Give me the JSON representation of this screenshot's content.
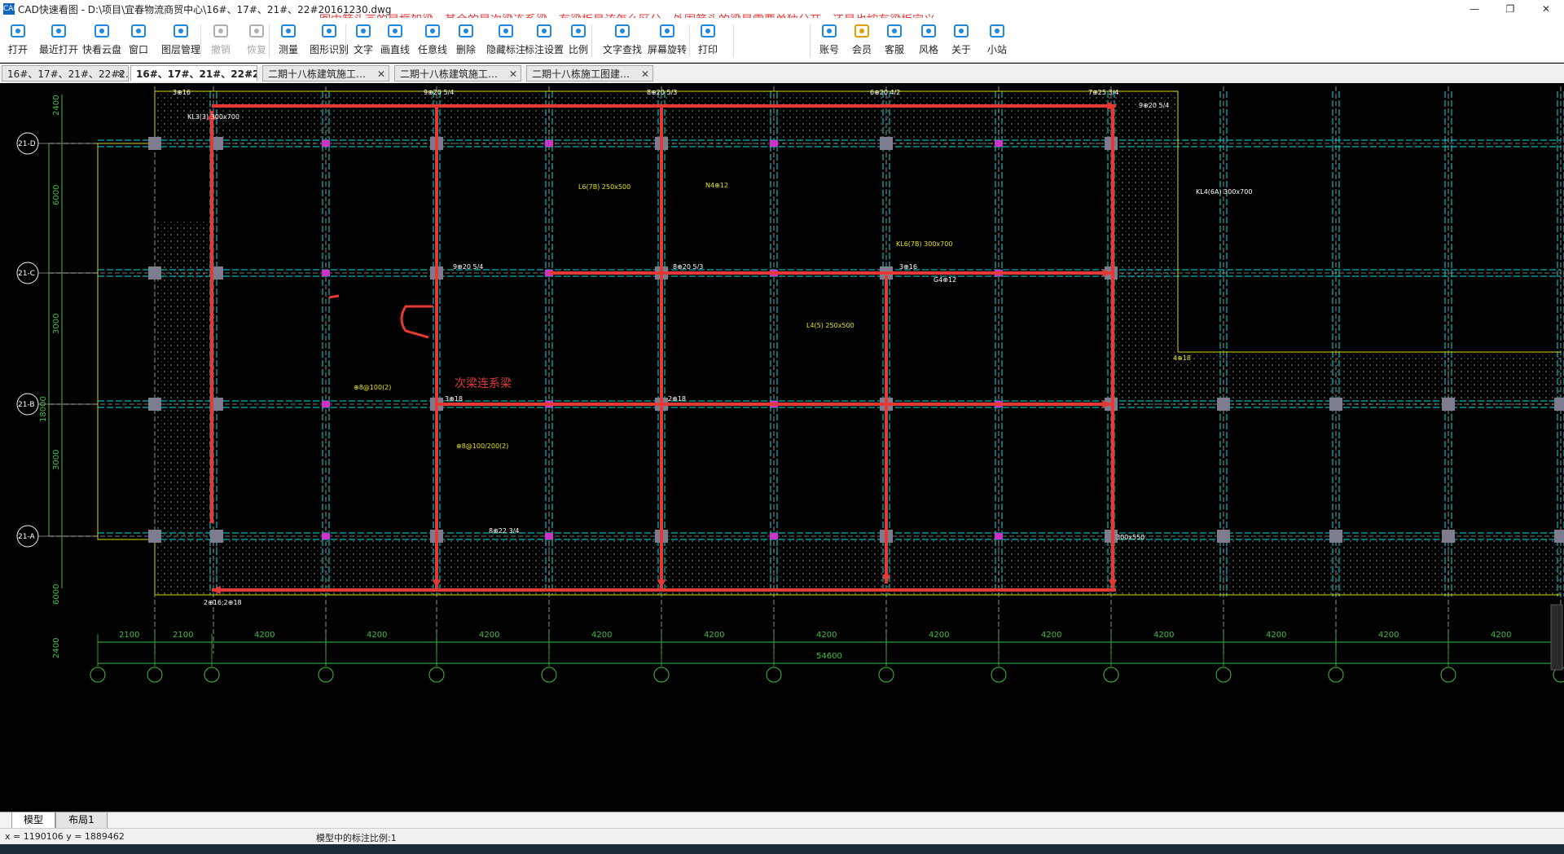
{
  "window": {
    "title": "CAD快速看图 - D:\\项目\\宜春物流商贸中心\\16#、17#、21#、22#20161230.dwg",
    "annotation": "图中箭头画的是框架梁，其余的是次梁连系梁，有梁板是该怎么区分，外围箭头的梁是需要单独分开，还是也按有梁板定义",
    "controls": [
      "—",
      "❐",
      "✕"
    ]
  },
  "toolbar": {
    "items": [
      {
        "label": "打开",
        "icon": "folder-open-icon",
        "enabled": true
      },
      {
        "label": "最近打开",
        "icon": "recent-icon",
        "enabled": true
      },
      {
        "label": "快看云盘",
        "icon": "cloud-icon",
        "enabled": true
      },
      {
        "label": "窗口",
        "icon": "window-icon",
        "enabled": true
      },
      {
        "label": "图层管理",
        "icon": "layers-icon",
        "enabled": true
      },
      {
        "label": "撤销",
        "icon": "undo-icon",
        "enabled": false
      },
      {
        "label": "恢复",
        "icon": "redo-icon",
        "enabled": false
      },
      {
        "label": "测量",
        "icon": "ruler-icon",
        "enabled": true
      },
      {
        "label": "图形识别",
        "icon": "shape-recognize-icon",
        "enabled": true
      },
      {
        "label": "文字",
        "icon": "text-icon",
        "enabled": true
      },
      {
        "label": "画直线",
        "icon": "line-icon",
        "enabled": true
      },
      {
        "label": "任意线",
        "icon": "freehand-icon",
        "enabled": true
      },
      {
        "label": "删除",
        "icon": "eraser-icon",
        "enabled": true
      },
      {
        "label": "隐藏标注",
        "icon": "hide-icon",
        "enabled": true
      },
      {
        "label": "标注设置",
        "icon": "settings-icon",
        "enabled": true
      },
      {
        "label": "比例",
        "icon": "scale-icon",
        "enabled": true
      },
      {
        "label": "文字查找",
        "icon": "find-text-icon",
        "enabled": true
      },
      {
        "label": "屏幕旋转",
        "icon": "rotate-icon",
        "enabled": true
      },
      {
        "label": "打印",
        "icon": "print-icon",
        "enabled": true
      },
      {
        "label": "账号",
        "icon": "account-icon",
        "enabled": true
      },
      {
        "label": "会员",
        "icon": "vip-icon",
        "enabled": true
      },
      {
        "label": "客服",
        "icon": "headset-icon",
        "enabled": true
      },
      {
        "label": "风格",
        "icon": "style-icon",
        "enabled": true
      },
      {
        "label": "关于",
        "icon": "info-icon",
        "enabled": true
      },
      {
        "label": "小站",
        "icon": "site-icon",
        "enabled": true
      }
    ]
  },
  "tabs": [
    {
      "label": "16#、17#、21#、22#2…",
      "active": false
    },
    {
      "label": "16#、17#、21#、22#2…",
      "active": true
    },
    {
      "label": "二期十八栋建筑施工…",
      "active": false
    },
    {
      "label": "二期十八栋建筑施工…",
      "active": false
    },
    {
      "label": "二期十八栋施工图建…",
      "active": false
    }
  ],
  "drawing": {
    "axis_rows": [
      "21-D",
      "21-C",
      "21-B",
      "21-A"
    ],
    "left_dims": [
      "2400",
      "6000",
      "3000",
      "18000",
      "3000",
      "6000",
      "2400"
    ],
    "bottom_dims": [
      "2100",
      "2100",
      "4200",
      "4200",
      "4200",
      "4200",
      "4200",
      "4200",
      "4200",
      "4200",
      "4200",
      "4200",
      "4200",
      "4200"
    ],
    "total_dim": "54600",
    "annotation_secondary": "次梁连系梁",
    "beam_labels": [
      "3⊕16",
      "9⊕20 5/4",
      "8⊕20 5/3",
      "6⊕20 4/2",
      "7⊕25 3/4",
      "9⊕20 5/4",
      "8⊕20 5/3",
      "3⊕16",
      "3⊕18",
      "2⊕18",
      "KL3(3) 300x700",
      "KL4(6A) 300x700",
      "L6(7B) 250x500",
      "L4(5) 250x500",
      "KL6(7B) 300x700",
      "⊕8@100(2)",
      "N4⊕12",
      "G4⊕12",
      "2⊕16;2⊕18",
      "9⊕20 5/4",
      "8⊕22 3/4",
      "300x550",
      "⊕8@100/200(2)",
      "4⊕18"
    ]
  },
  "layout_tabs": [
    "模型",
    "布局1"
  ],
  "status": {
    "coords": "x = 1190106  y = 1889462",
    "scale": "模型中的标注比例:1"
  },
  "colors": {
    "canvas_bg": "#000000",
    "beam_line": "#00e5e5",
    "grid_line": "#f2f2f2",
    "annotation_red": "#e53935",
    "dim_green": "#3fbf3f",
    "label_yellow": "#e5e500",
    "label_white": "#ffffff",
    "column_fill": "#7d7d8f"
  }
}
